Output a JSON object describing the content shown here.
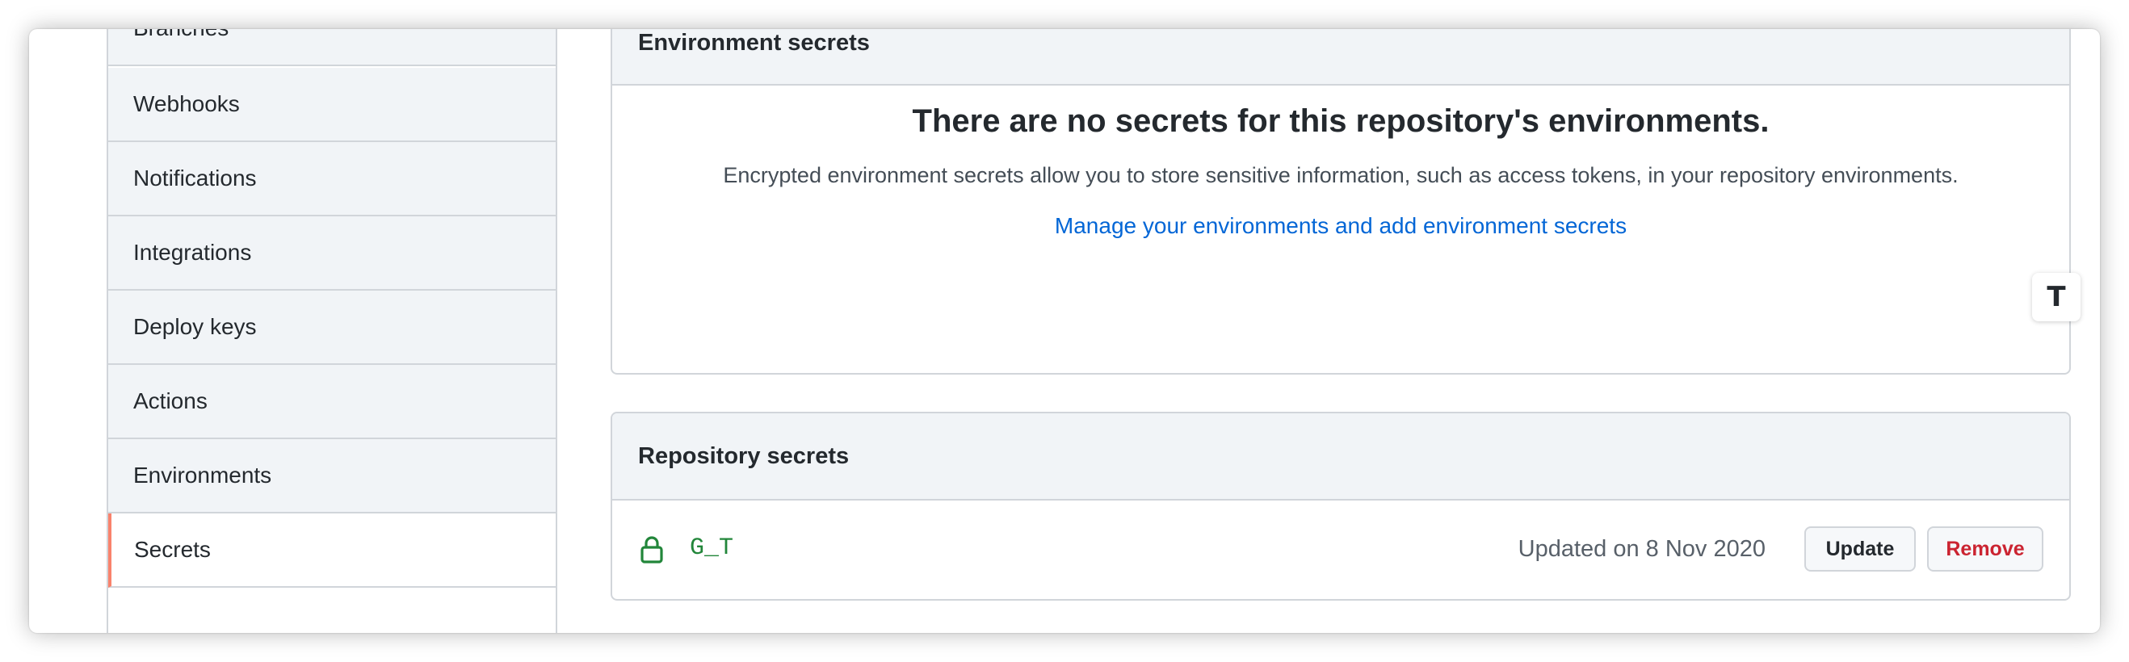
{
  "sidebar": {
    "items": [
      {
        "label": "Branches",
        "active": false
      },
      {
        "label": "Webhooks",
        "active": false
      },
      {
        "label": "Notifications",
        "active": false
      },
      {
        "label": "Integrations",
        "active": false
      },
      {
        "label": "Deploy keys",
        "active": false
      },
      {
        "label": "Actions",
        "active": false
      },
      {
        "label": "Environments",
        "active": false
      },
      {
        "label": "Secrets",
        "active": true
      }
    ]
  },
  "environment_secrets": {
    "header": "Environment secrets",
    "blank_title": "There are no secrets for this repository's environments.",
    "blank_description": "Encrypted environment secrets allow you to store sensitive information, such as access tokens, in your repository environments.",
    "manage_link": "Manage your environments and add environment secrets"
  },
  "repository_secrets": {
    "header": "Repository secrets",
    "secrets": [
      {
        "name": "G_T",
        "icon": "lock-icon",
        "updated": "Updated on 8 Nov 2020",
        "update_label": "Update",
        "remove_label": "Remove"
      }
    ]
  },
  "floating_button": {
    "icon": "text-format-icon",
    "glyph": "T"
  },
  "colors": {
    "active_accent": "#f9826c",
    "link": "#0366d6",
    "secret_name": "#22863a",
    "remove": "#cb2431"
  }
}
